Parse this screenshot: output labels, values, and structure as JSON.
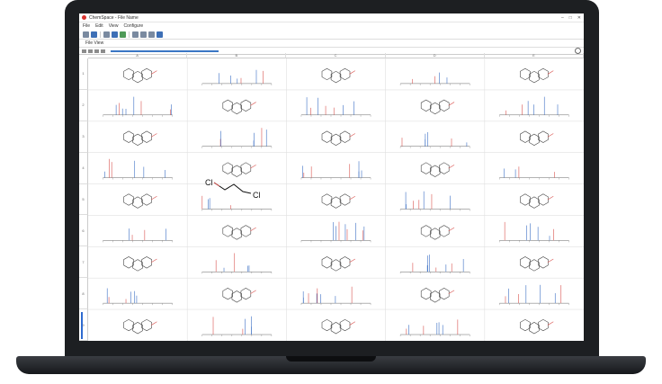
{
  "window": {
    "title": "ChemSpace - File Name"
  },
  "menu": [
    "File",
    "Edit",
    "View",
    "Configure"
  ],
  "tabs": [
    "File View"
  ],
  "grid": {
    "columns": [
      "A",
      "B",
      "C",
      "D",
      "E"
    ],
    "rows": [
      "1",
      "2",
      "3",
      "4",
      "5",
      "6",
      "7",
      "8",
      "9"
    ],
    "labels": {
      "chloro_molecule": "Cl"
    }
  },
  "colors": {
    "spectrum_red": "#d9534f",
    "spectrum_blue": "#3b6fc4",
    "selection": "#2f6bd0"
  }
}
